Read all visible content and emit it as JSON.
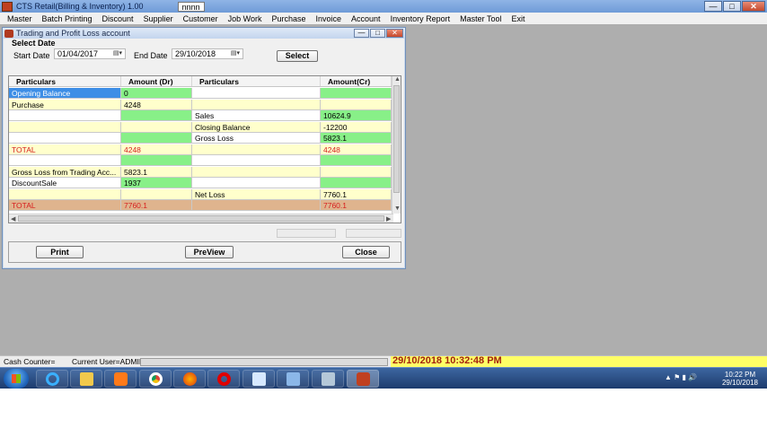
{
  "app": {
    "title": "CTS Retail(Billing & Inventory) 1.00",
    "tab": "nnnn"
  },
  "menu": [
    "Master",
    "Batch Printing",
    "Discount",
    "Supplier",
    "Customer",
    "Job Work",
    "Purchase",
    "Invoice",
    "Account",
    "Inventory Report",
    "Master Tool",
    "Exit"
  ],
  "window": {
    "title": "Trading and Profit Loss account",
    "select_date_label": "Select Date",
    "start_label": "Start Date",
    "start_value": "01/04/2017",
    "end_label": "End Date",
    "end_value": "29/10/2018",
    "select_button": "Select",
    "columns": [
      "Particulars",
      "Amount (Dr)",
      "Particulars",
      "Amount(Cr)"
    ],
    "rows": [
      {
        "c1": "Opening Balance",
        "c2": "0",
        "c3": "",
        "c4": "",
        "bg": [
          "sel",
          "g",
          "w",
          "g"
        ]
      },
      {
        "c1": "Purchase",
        "c2": "4248",
        "c3": "",
        "c4": "",
        "bg": [
          "y",
          "y",
          "y",
          "y"
        ]
      },
      {
        "c1": "",
        "c2": "",
        "c3": "Sales",
        "c4": "10624.9",
        "bg": [
          "w",
          "g",
          "w",
          "g"
        ]
      },
      {
        "c1": "",
        "c2": "",
        "c3": "Closing Balance",
        "c4": "-12200",
        "bg": [
          "y",
          "y",
          "y",
          "y"
        ]
      },
      {
        "c1": "",
        "c2": "",
        "c3": "Gross Loss",
        "c4": "5823.1",
        "bg": [
          "w",
          "g",
          "w",
          "g"
        ]
      },
      {
        "c1": "TOTAL",
        "c2": "4248",
        "c3": "",
        "c4": "4248",
        "bg": [
          "y",
          "y",
          "y",
          "y"
        ],
        "red": true
      },
      {
        "c1": "",
        "c2": "",
        "c3": "",
        "c4": "",
        "bg": [
          "w",
          "g",
          "w",
          "g"
        ]
      },
      {
        "c1": "Gross Loss  from Trading Acc...",
        "c2": "5823.1",
        "c3": "",
        "c4": "",
        "bg": [
          "y",
          "y",
          "y",
          "y"
        ]
      },
      {
        "c1": "DiscountSale",
        "c2": "1937",
        "c3": "",
        "c4": "",
        "bg": [
          "w",
          "g",
          "w",
          "g"
        ]
      },
      {
        "c1": "",
        "c2": "",
        "c3": "Net Loss",
        "c4": "7760.1",
        "bg": [
          "y",
          "y",
          "y",
          "y"
        ]
      },
      {
        "c1": "TOTAL",
        "c2": "7760.1",
        "c3": "",
        "c4": "7760.1",
        "bg": [
          "tot",
          "tot",
          "tot",
          "tot"
        ],
        "red": true
      }
    ],
    "print_button": "Print",
    "preview_button": "PreView",
    "close_button": "Close"
  },
  "status": {
    "cash_counter": "Cash Counter=",
    "current_user": "Current User=ADMIN",
    "datetime": "29/10/2018 10:32:48 PM"
  },
  "taskbar": {
    "time": "10:22 PM",
    "date": "29/10/2018",
    "icons": [
      "start-icon",
      "ie-icon",
      "folder-icon",
      "media-player-icon",
      "chrome-icon",
      "firefox-icon",
      "opera-icon",
      "notepad-icon",
      "network-icon",
      "tools-icon",
      "cts-retail-icon"
    ]
  }
}
